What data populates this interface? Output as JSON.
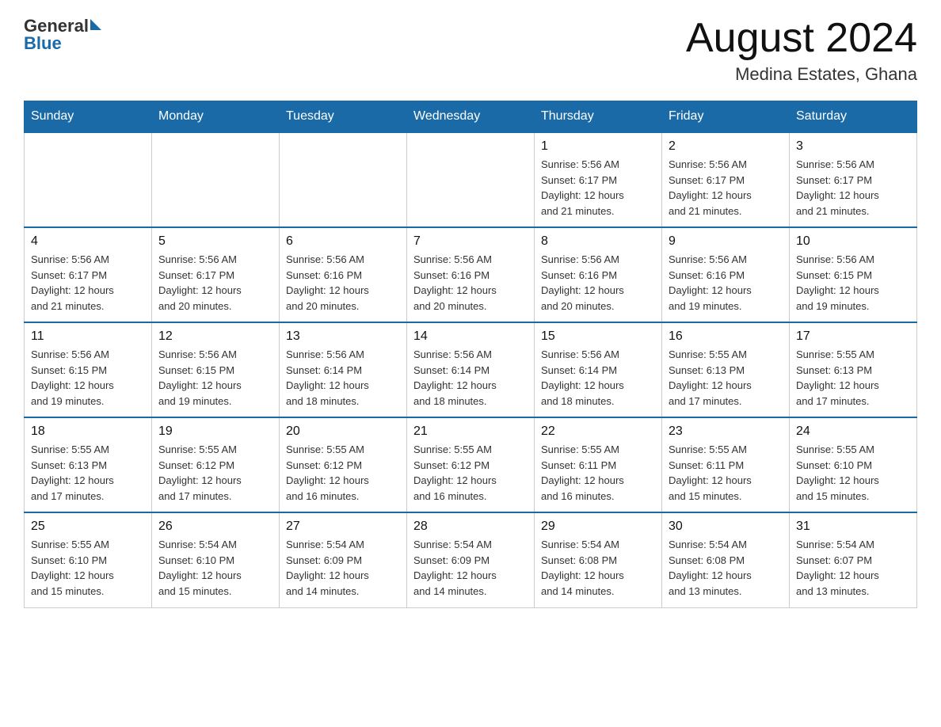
{
  "header": {
    "logo_general": "General",
    "logo_blue": "Blue",
    "title": "August 2024",
    "location": "Medina Estates, Ghana"
  },
  "days_of_week": [
    "Sunday",
    "Monday",
    "Tuesday",
    "Wednesday",
    "Thursday",
    "Friday",
    "Saturday"
  ],
  "weeks": [
    [
      {
        "day": "",
        "info": ""
      },
      {
        "day": "",
        "info": ""
      },
      {
        "day": "",
        "info": ""
      },
      {
        "day": "",
        "info": ""
      },
      {
        "day": "1",
        "info": "Sunrise: 5:56 AM\nSunset: 6:17 PM\nDaylight: 12 hours\nand 21 minutes."
      },
      {
        "day": "2",
        "info": "Sunrise: 5:56 AM\nSunset: 6:17 PM\nDaylight: 12 hours\nand 21 minutes."
      },
      {
        "day": "3",
        "info": "Sunrise: 5:56 AM\nSunset: 6:17 PM\nDaylight: 12 hours\nand 21 minutes."
      }
    ],
    [
      {
        "day": "4",
        "info": "Sunrise: 5:56 AM\nSunset: 6:17 PM\nDaylight: 12 hours\nand 21 minutes."
      },
      {
        "day": "5",
        "info": "Sunrise: 5:56 AM\nSunset: 6:17 PM\nDaylight: 12 hours\nand 20 minutes."
      },
      {
        "day": "6",
        "info": "Sunrise: 5:56 AM\nSunset: 6:16 PM\nDaylight: 12 hours\nand 20 minutes."
      },
      {
        "day": "7",
        "info": "Sunrise: 5:56 AM\nSunset: 6:16 PM\nDaylight: 12 hours\nand 20 minutes."
      },
      {
        "day": "8",
        "info": "Sunrise: 5:56 AM\nSunset: 6:16 PM\nDaylight: 12 hours\nand 20 minutes."
      },
      {
        "day": "9",
        "info": "Sunrise: 5:56 AM\nSunset: 6:16 PM\nDaylight: 12 hours\nand 19 minutes."
      },
      {
        "day": "10",
        "info": "Sunrise: 5:56 AM\nSunset: 6:15 PM\nDaylight: 12 hours\nand 19 minutes."
      }
    ],
    [
      {
        "day": "11",
        "info": "Sunrise: 5:56 AM\nSunset: 6:15 PM\nDaylight: 12 hours\nand 19 minutes."
      },
      {
        "day": "12",
        "info": "Sunrise: 5:56 AM\nSunset: 6:15 PM\nDaylight: 12 hours\nand 19 minutes."
      },
      {
        "day": "13",
        "info": "Sunrise: 5:56 AM\nSunset: 6:14 PM\nDaylight: 12 hours\nand 18 minutes."
      },
      {
        "day": "14",
        "info": "Sunrise: 5:56 AM\nSunset: 6:14 PM\nDaylight: 12 hours\nand 18 minutes."
      },
      {
        "day": "15",
        "info": "Sunrise: 5:56 AM\nSunset: 6:14 PM\nDaylight: 12 hours\nand 18 minutes."
      },
      {
        "day": "16",
        "info": "Sunrise: 5:55 AM\nSunset: 6:13 PM\nDaylight: 12 hours\nand 17 minutes."
      },
      {
        "day": "17",
        "info": "Sunrise: 5:55 AM\nSunset: 6:13 PM\nDaylight: 12 hours\nand 17 minutes."
      }
    ],
    [
      {
        "day": "18",
        "info": "Sunrise: 5:55 AM\nSunset: 6:13 PM\nDaylight: 12 hours\nand 17 minutes."
      },
      {
        "day": "19",
        "info": "Sunrise: 5:55 AM\nSunset: 6:12 PM\nDaylight: 12 hours\nand 17 minutes."
      },
      {
        "day": "20",
        "info": "Sunrise: 5:55 AM\nSunset: 6:12 PM\nDaylight: 12 hours\nand 16 minutes."
      },
      {
        "day": "21",
        "info": "Sunrise: 5:55 AM\nSunset: 6:12 PM\nDaylight: 12 hours\nand 16 minutes."
      },
      {
        "day": "22",
        "info": "Sunrise: 5:55 AM\nSunset: 6:11 PM\nDaylight: 12 hours\nand 16 minutes."
      },
      {
        "day": "23",
        "info": "Sunrise: 5:55 AM\nSunset: 6:11 PM\nDaylight: 12 hours\nand 15 minutes."
      },
      {
        "day": "24",
        "info": "Sunrise: 5:55 AM\nSunset: 6:10 PM\nDaylight: 12 hours\nand 15 minutes."
      }
    ],
    [
      {
        "day": "25",
        "info": "Sunrise: 5:55 AM\nSunset: 6:10 PM\nDaylight: 12 hours\nand 15 minutes."
      },
      {
        "day": "26",
        "info": "Sunrise: 5:54 AM\nSunset: 6:10 PM\nDaylight: 12 hours\nand 15 minutes."
      },
      {
        "day": "27",
        "info": "Sunrise: 5:54 AM\nSunset: 6:09 PM\nDaylight: 12 hours\nand 14 minutes."
      },
      {
        "day": "28",
        "info": "Sunrise: 5:54 AM\nSunset: 6:09 PM\nDaylight: 12 hours\nand 14 minutes."
      },
      {
        "day": "29",
        "info": "Sunrise: 5:54 AM\nSunset: 6:08 PM\nDaylight: 12 hours\nand 14 minutes."
      },
      {
        "day": "30",
        "info": "Sunrise: 5:54 AM\nSunset: 6:08 PM\nDaylight: 12 hours\nand 13 minutes."
      },
      {
        "day": "31",
        "info": "Sunrise: 5:54 AM\nSunset: 6:07 PM\nDaylight: 12 hours\nand 13 minutes."
      }
    ]
  ]
}
